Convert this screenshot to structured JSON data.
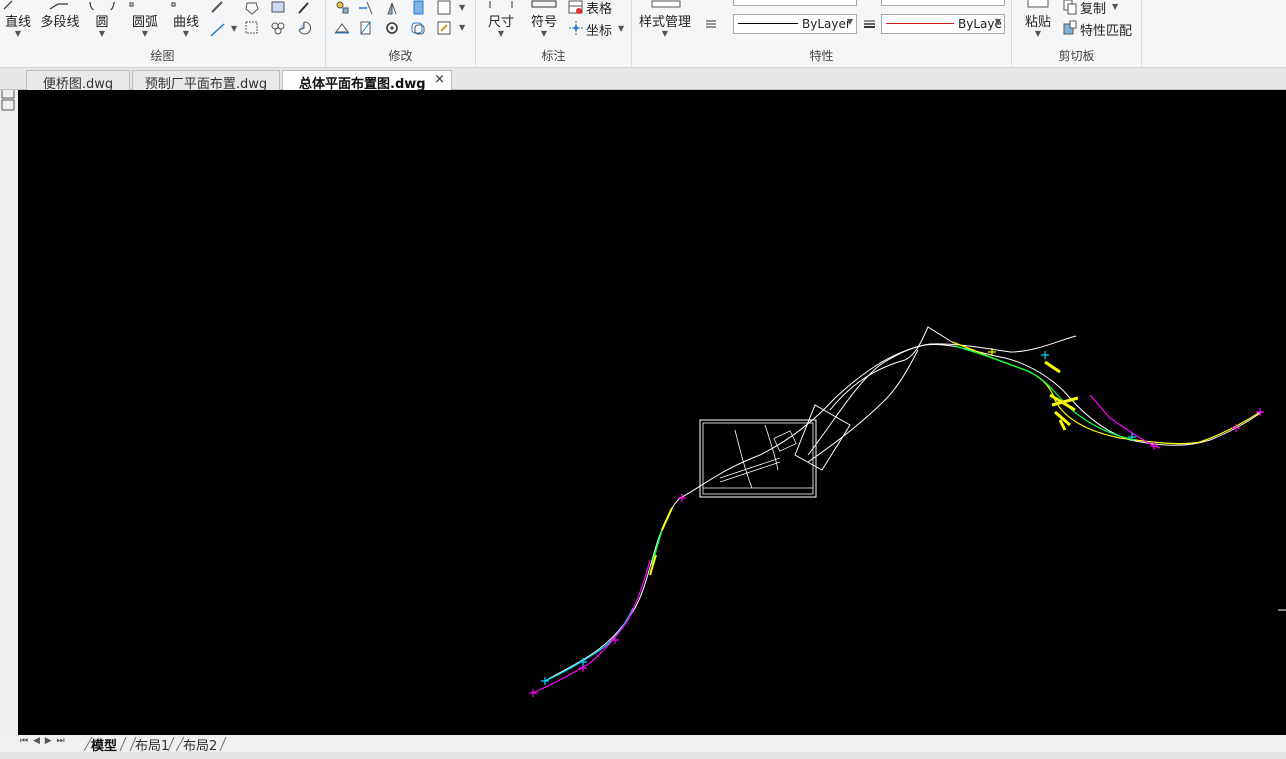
{
  "ribbon": {
    "draw": {
      "line_label": "直线",
      "polyline_label": "多段线",
      "circle_label": "圆",
      "arc_label": "圆弧",
      "curve_label": "曲线",
      "group_label": "绘图"
    },
    "modify": {
      "group_label": "修改"
    },
    "annotate": {
      "dimension_label": "尺寸",
      "symbol_label": "符号",
      "table_label": "表格",
      "coordinate_label": "坐标",
      "group_label": "标注"
    },
    "properties": {
      "style_manager_label": "样式管理",
      "linetype_value": "ByLayer",
      "lineweight_value": "ByLaye",
      "group_label": "特性",
      "linetype_color": "#000000",
      "lineweight_color": "#d01818"
    },
    "clipboard": {
      "paste_label": "粘贴",
      "copy_label": "复制",
      "match_props_label": "特性匹配",
      "group_label": "剪切板"
    }
  },
  "tabs": {
    "tab1": "便桥图.dwg",
    "tab2": "预制厂平面布置.dwg",
    "tab3": "总体平面布置图.dwg",
    "close_glyph": "×"
  },
  "layout_tabs": {
    "nav": "⏮ ◀ ▶ ⏭",
    "model": "模型",
    "layout1": "布局1",
    "layout2": "布局2"
  },
  "colors": {
    "canvas_bg": "#000000",
    "road_white": "#ffffff",
    "magenta": "#ff00ff",
    "cyan": "#00d8ff",
    "yellow": "#ffff00",
    "green": "#00ff40"
  }
}
